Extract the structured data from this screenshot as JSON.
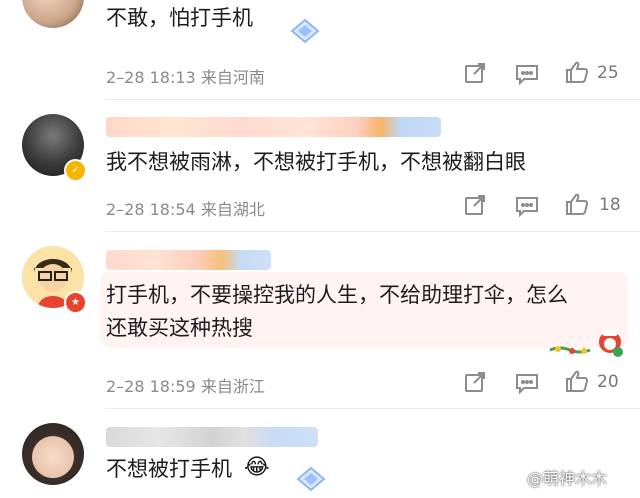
{
  "comments": [
    {
      "text": "不敢，怕打手机",
      "meta": "2–28 18:13  来自河南",
      "likes": "25"
    },
    {
      "text": "我不想被雨淋，不想被打手机，不想被翻白眼",
      "meta": "2–28 18:54  来自湖北",
      "likes": "18"
    },
    {
      "text_line1": "打手机，不要操控我的人生，不给助理打伞，怎么",
      "text_line2": "还敢买这种热搜",
      "meta": "2–28 18:59  来自浙江",
      "likes": "20"
    },
    {
      "text": "不想被打手机",
      "emoji": "😂"
    }
  ],
  "watermark": "@萌神木木",
  "icons": {
    "share": "share-icon",
    "comment": "comment-icon",
    "like": "thumbs-up-icon",
    "verified": "verified-badge-icon",
    "diamond": "blue-diamond-icon"
  },
  "colors": {
    "meta_gray": "#8a8a8a",
    "verified_yellow": "#f5b500",
    "badge_red": "#e8432f",
    "bubble_pink": "#fff3f1"
  }
}
